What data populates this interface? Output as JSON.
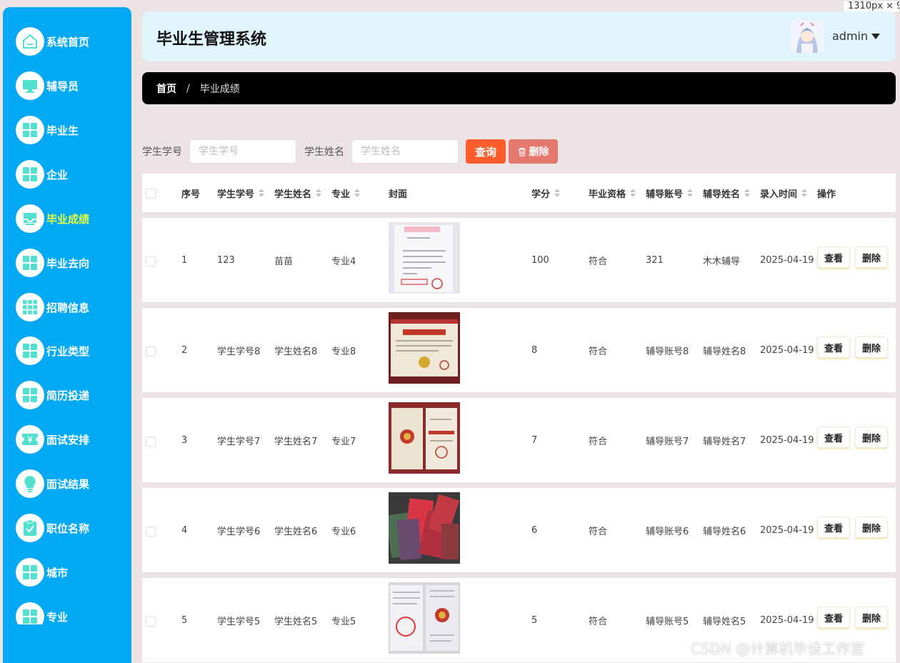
{
  "viewport_badge": "1310px × 9",
  "sidebar": {
    "items": [
      {
        "label": "系统首页",
        "icon": "home-icon"
      },
      {
        "label": "辅导员",
        "icon": "monitor-icon"
      },
      {
        "label": "毕业生",
        "icon": "grid-icon"
      },
      {
        "label": "企业",
        "icon": "grid-icon"
      },
      {
        "label": "毕业成绩",
        "icon": "tray-icon",
        "active": true
      },
      {
        "label": "毕业去向",
        "icon": "grid-icon"
      },
      {
        "label": "招聘信息",
        "icon": "apps-icon"
      },
      {
        "label": "行业类型",
        "icon": "grid-icon"
      },
      {
        "label": "简历投递",
        "icon": "grid-icon"
      },
      {
        "label": "面试安排",
        "icon": "ticket-icon"
      },
      {
        "label": "面试结果",
        "icon": "bulb-icon"
      },
      {
        "label": "职位名称",
        "icon": "clipboard-icon"
      },
      {
        "label": "城市",
        "icon": "grid-icon"
      },
      {
        "label": "专业",
        "icon": "grid-icon"
      }
    ]
  },
  "header": {
    "title": "毕业生管理系统",
    "user": "admin"
  },
  "breadcrumb": {
    "home": "首页",
    "separator": "/",
    "current": "毕业成绩"
  },
  "search": {
    "student_id_label": "学生学号",
    "student_id_placeholder": "学生学号",
    "student_name_label": "学生姓名",
    "student_name_placeholder": "学生姓名",
    "query_button": "查询",
    "delete_button": "删除"
  },
  "table": {
    "headers": {
      "index": "序号",
      "student_id": "学生学号",
      "student_name": "学生姓名",
      "major": "专业",
      "cover": "封面",
      "credits": "学分",
      "qualification": "毕业资格",
      "advisor_account": "辅导账号",
      "advisor_name": "辅导姓名",
      "created": "录入时间",
      "actions": "操作"
    },
    "view_label": "查看",
    "delete_label": "删除",
    "rows": [
      {
        "index": "1",
        "student_id": "123",
        "student_name": "苗苗",
        "major": "专业4",
        "credits": "100",
        "qualification": "符合",
        "advisor_account": "321",
        "advisor_name": "木木辅导",
        "created": "2025-04-19"
      },
      {
        "index": "2",
        "student_id": "学生学号8",
        "student_name": "学生姓名8",
        "major": "专业8",
        "credits": "8",
        "qualification": "符合",
        "advisor_account": "辅导账号8",
        "advisor_name": "辅导姓名8",
        "created": "2025-04-19"
      },
      {
        "index": "3",
        "student_id": "学生学号7",
        "student_name": "学生姓名7",
        "major": "专业7",
        "credits": "7",
        "qualification": "符合",
        "advisor_account": "辅导账号7",
        "advisor_name": "辅导姓名7",
        "created": "2025-04-19"
      },
      {
        "index": "4",
        "student_id": "学生学号6",
        "student_name": "学生姓名6",
        "major": "专业6",
        "credits": "6",
        "qualification": "符合",
        "advisor_account": "辅导账号6",
        "advisor_name": "辅导姓名6",
        "created": "2025-04-19"
      },
      {
        "index": "5",
        "student_id": "学生学号5",
        "student_name": "学生姓名5",
        "major": "专业5",
        "credits": "5",
        "qualification": "符合",
        "advisor_account": "辅导账号5",
        "advisor_name": "辅导姓名5",
        "created": "2025-04-19"
      }
    ]
  },
  "watermark": "CSDN @计算机毕设工作室",
  "colors": {
    "sidebar": "#03a9f4",
    "active_label": "#e6ff3a",
    "header_bg": "#e0f4fc",
    "query_button": "#ff5e2c",
    "delete_button": "#e5786f",
    "icon_accent": "#4fe0d0"
  }
}
